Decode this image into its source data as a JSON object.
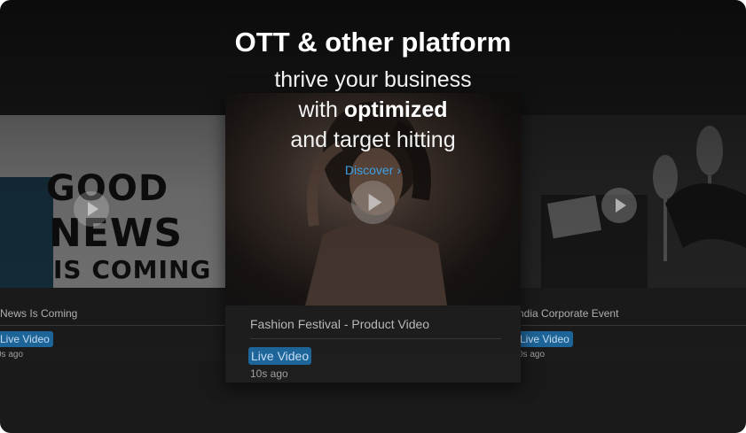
{
  "hero": {
    "title": "OTT & other platform",
    "line1": "thrive your business",
    "line2_prefix": "with",
    "line2_bold": "optimized",
    "line3": "and target hitting",
    "cta_label": "Discover",
    "cta_icon": "chevron-right-icon"
  },
  "cards": {
    "left": {
      "title": "News Is Coming",
      "badge": "Live Video",
      "time": "0s ago",
      "poster_line1": "GOOD",
      "poster_line2": "NEWS",
      "poster_line3": "IS COMING"
    },
    "center": {
      "title": "Fashion Festival - Product Video",
      "badge": "Live Video",
      "time": "10s ago"
    },
    "right": {
      "title": "ndia Corporate Event",
      "badge": "Live Video",
      "time": "0s ago"
    }
  },
  "colors": {
    "accent": "#3da0e6",
    "badge_bg": "#1f6aa1",
    "background": "#1a1a1a"
  }
}
